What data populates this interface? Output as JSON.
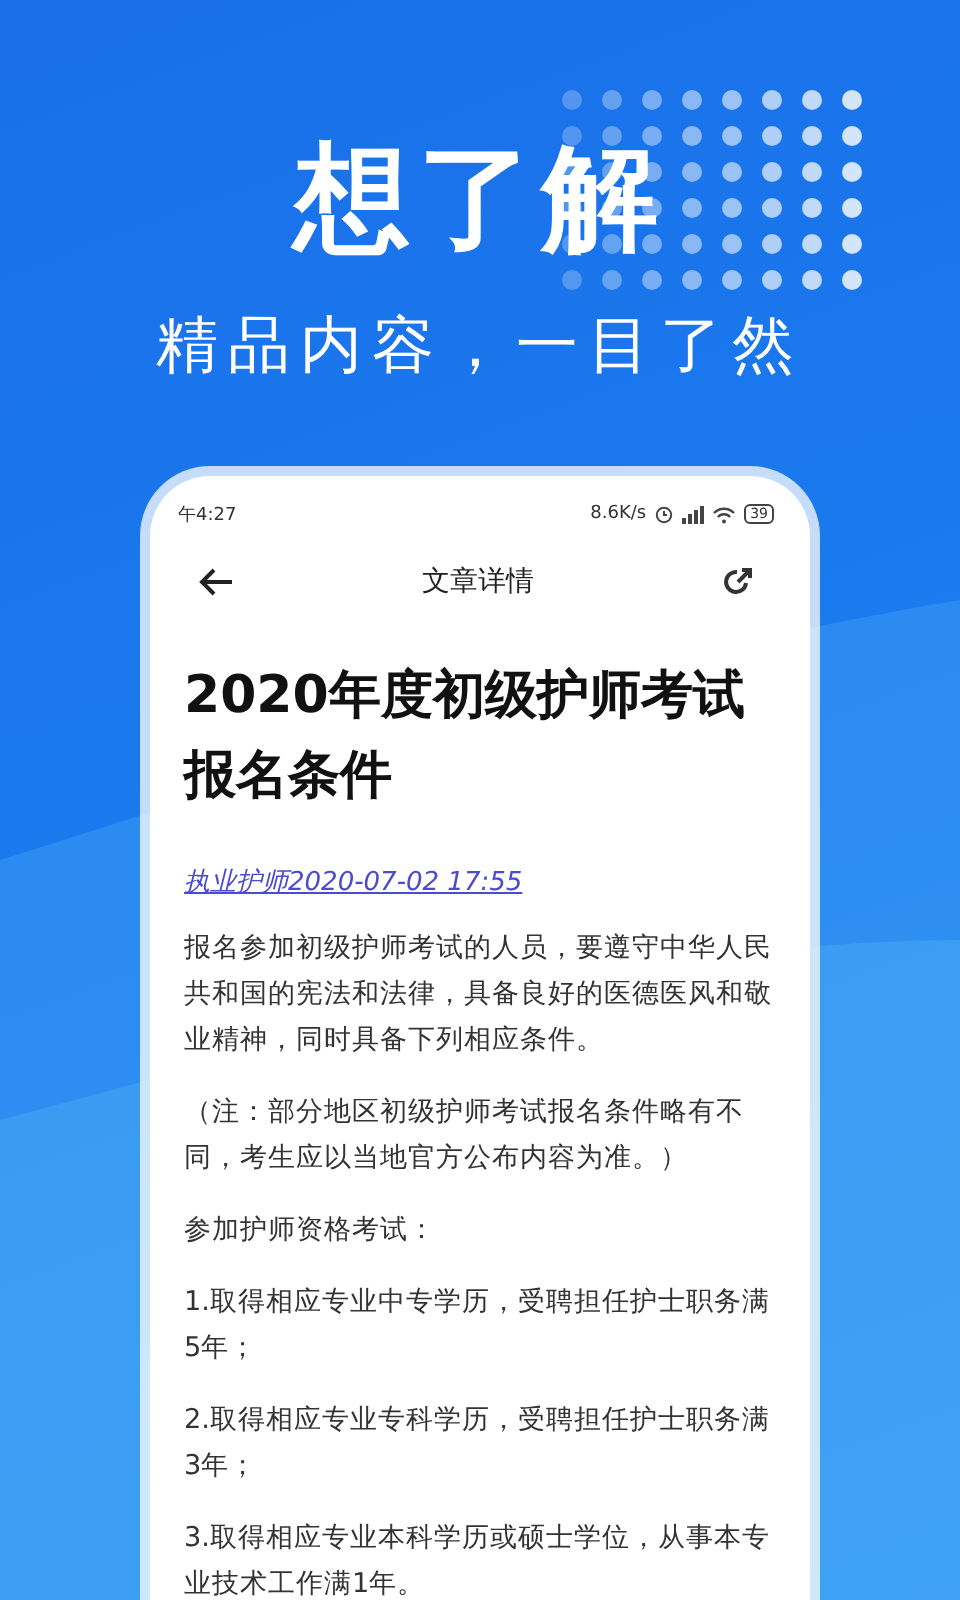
{
  "headline": "想了解",
  "subheadline": "精品内容，一目了然",
  "status_bar": {
    "time": "午4:27",
    "speed": "8.6K/s",
    "battery": "39"
  },
  "nav": {
    "title": "文章详情"
  },
  "article": {
    "title": "2020年度初级护师考试报名条件",
    "source_link": "执业护师2020-07-02 17:55",
    "paragraphs": [
      "报名参加初级护师考试的人员，要遵守中华人民共和国的宪法和法律，具备良好的医德医风和敬业精神，同时具备下列相应条件。",
      "（注：部分地区初级护师考试报名条件略有不同，考生应以当地官方公布内容为准。）",
      "参加护师资格考试：",
      "1.取得相应专业中专学历，受聘担任护士职务满5年；",
      "2.取得相应专业专科学历，受聘担任护士职务满3年；",
      "3.取得相应专业本科学历或硕士学位，从事本专业技术工作满1年。"
    ]
  }
}
